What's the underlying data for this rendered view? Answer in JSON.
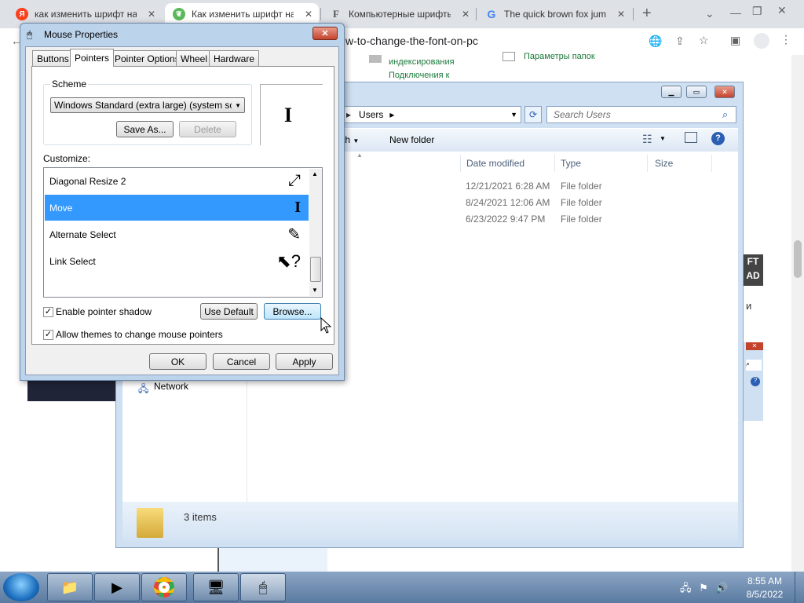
{
  "browser": {
    "tabs": [
      {
        "title": "как изменить шрифт на",
        "favicon": "Я",
        "active": false
      },
      {
        "title": "Как изменить шрифт на",
        "favicon": "leaf",
        "active": true
      },
      {
        "title": "Компьютерные шрифты",
        "favicon": "F",
        "active": false
      },
      {
        "title": "The quick brown fox jum",
        "favicon": "G",
        "active": false
      }
    ],
    "new_tab": "+",
    "url": "w-to-change-the-font-on-pc"
  },
  "page": {
    "link1": "индексирования",
    "link2": "Подключения к",
    "link3": "Параметры папок",
    "side_text": "и",
    "logo_text1": "FT",
    "logo_text2": "AD"
  },
  "explorer": {
    "address": "Users",
    "search_placeholder": "Search Users",
    "cmd_partial": "th",
    "new_folder": "New folder",
    "columns": {
      "date": "Date modified",
      "type": "Type",
      "size": "Size"
    },
    "rows": [
      {
        "date": "12/21/2021 6:28 AM",
        "type": "File folder"
      },
      {
        "date": "8/24/2021 12:06 AM",
        "type": "File folder"
      },
      {
        "date": "6/23/2022 9:47 PM",
        "type": "File folder"
      }
    ],
    "nav_network": "Network",
    "status": "3 items"
  },
  "dialog": {
    "title": "Mouse Properties",
    "tabs": [
      "Buttons",
      "Pointers",
      "Pointer Options",
      "Wheel",
      "Hardware"
    ],
    "active_tab": "Pointers",
    "scheme_label": "Scheme",
    "scheme_value": "Windows Standard (extra large) (system scheme",
    "save_as": "Save As...",
    "delete": "Delete",
    "customize_label": "Customize:",
    "pointers": [
      {
        "name": "Diagonal Resize 2",
        "icon": "diagonal-resize-icon",
        "selected": false
      },
      {
        "name": "Move",
        "icon": "text-beam-icon",
        "selected": true
      },
      {
        "name": "Alternate Select",
        "icon": "pen-icon",
        "selected": false
      },
      {
        "name": "Link Select",
        "icon": "help-arrow-icon",
        "selected": false
      }
    ],
    "enable_shadow": "Enable pointer shadow",
    "allow_themes": "Allow themes to change mouse pointers",
    "use_default": "Use Default",
    "browse": "Browse...",
    "ok": "OK",
    "cancel": "Cancel",
    "apply": "Apply"
  },
  "taskbar": {
    "time": "8:55 AM",
    "date": "8/5/2022"
  }
}
